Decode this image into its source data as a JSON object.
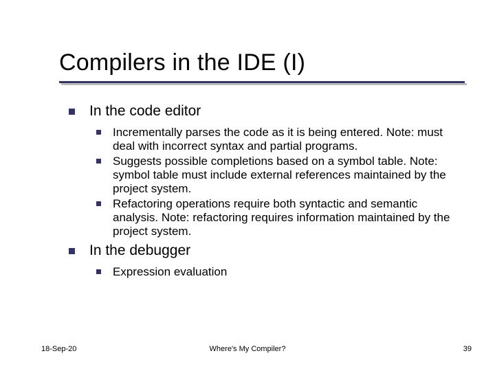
{
  "title": "Compilers in the IDE (I)",
  "section1": {
    "heading": "In the code editor",
    "items": [
      "Incrementally parses the code as it is being entered.  Note: must deal with incorrect syntax and partial programs.",
      "Suggests possible completions based on a symbol table.  Note: symbol table must include external references maintained by the project system.",
      "Refactoring operations require both syntactic and semantic analysis.  Note: refactoring requires information maintained by the project system."
    ]
  },
  "section2": {
    "heading": "In the debugger",
    "items": [
      "Expression evaluation"
    ]
  },
  "footer": {
    "date": "18-Sep-20",
    "center": "Where's My Compiler?",
    "page": "39"
  }
}
